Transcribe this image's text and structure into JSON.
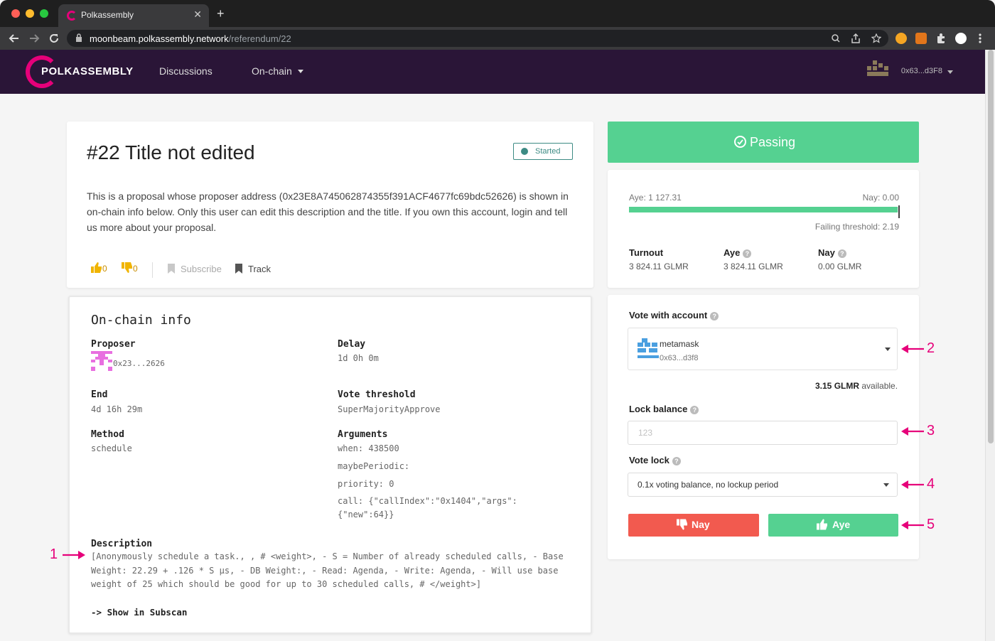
{
  "browser": {
    "tab_title": "Polkassembly",
    "tab_close": "✕",
    "new_tab": "+",
    "url_host": "moonbeam.polkassembly.network",
    "url_path": "/referendum/22"
  },
  "nav": {
    "logo": "POLKASSEMBLY",
    "discussions": "Discussions",
    "onchain": "On-chain",
    "account": "0x63...d3F8"
  },
  "post": {
    "title": "#22 Title not edited",
    "status": "Started",
    "body": "This is a proposal whose proposer address (0x23E8A745062874355f391ACF4677fc69bdc52626) is shown in on-chain info below. Only this user can edit this description and the title. If you own this account, login and tell us more about your proposal.",
    "likes": "0",
    "dislikes": "0",
    "subscribe": "Subscribe",
    "track": "Track"
  },
  "onchain": {
    "title": "On-chain info",
    "proposer_label": "Proposer",
    "proposer_value": "0x23...2626",
    "delay_label": "Delay",
    "delay_value": "1d 0h 0m",
    "end_label": "End",
    "end_value": "4d 16h 29m",
    "threshold_label": "Vote threshold",
    "threshold_value": "SuperMajorityApprove",
    "method_label": "Method",
    "method_value": "schedule",
    "arguments_label": "Arguments",
    "arg_when": "when: 438500",
    "arg_periodic": "maybePeriodic:",
    "arg_priority": "priority: 0",
    "arg_call_1": "call: {\"callIndex\":\"0x1404\",\"args\":",
    "arg_call_2": "{\"new\":64}}",
    "description_label": "Description",
    "description_value": "[Anonymously schedule a task., , # <weight>, - S = Number of already scheduled calls, - Base Weight: 22.29 + .126 * S µs, - DB Weight:, - Read: Agenda, - Write: Agenda, - Will use base weight of 25 which should be good for up to 30 scheduled calls, # </weight>]",
    "subscan": "-> Show in Subscan"
  },
  "status": {
    "label": "Passing",
    "aye_label": "Aye: 1 127.31",
    "nay_label": "Nay: 0.00",
    "aye_fraction": 0.995,
    "threshold": "Failing threshold: 2.19",
    "turnout_label": "Turnout",
    "turnout_value": "3 824.11 GLMR",
    "aye_title": "Aye",
    "aye_value": "3 824.11 GLMR",
    "nay_title": "Nay",
    "nay_value": "0.00 GLMR"
  },
  "vote": {
    "account_label": "Vote with account",
    "account_name": "metamask",
    "account_addr": "0x63...d3f8",
    "available_amount": "3.15 GLMR",
    "available_suffix": " available.",
    "lock_label": "Lock balance",
    "lock_placeholder": "123",
    "votelock_label": "Vote lock",
    "votelock_value": "0.1x voting balance, no lockup period",
    "nay_button": "Nay",
    "aye_button": "Aye"
  },
  "annotations": [
    "1",
    "2",
    "3",
    "4",
    "5"
  ],
  "colors": {
    "accent_pink": "#e6007a",
    "nav_bg": "#2a1537",
    "passing_green": "#55d191",
    "nay_red": "#f25a4f",
    "status_teal": "#3d8b84"
  }
}
